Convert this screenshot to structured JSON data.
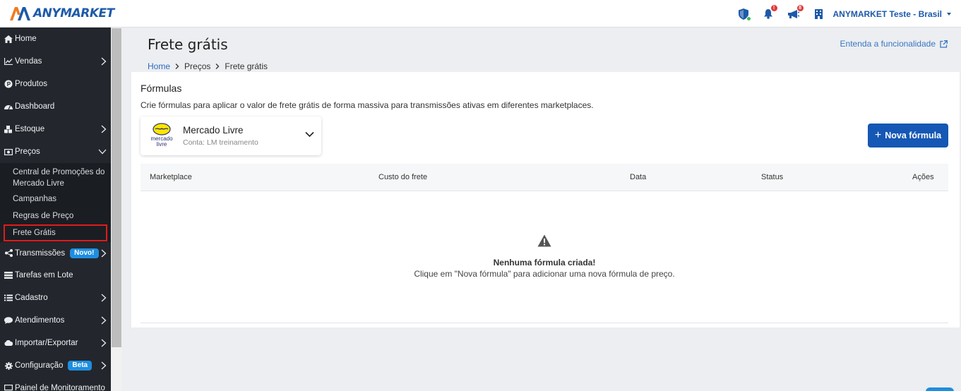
{
  "brand": {
    "name": "ANYMARKET",
    "color": "#1d5aa9",
    "accent": "#f07b1f"
  },
  "header": {
    "account_name": "ANYMARKET Teste - Brasil",
    "notifications_badge": "!",
    "announcements_badge": "8",
    "icons": [
      "shield-check-icon",
      "bell-icon",
      "megaphone-icon",
      "building-icon"
    ]
  },
  "sidebar": {
    "items": [
      {
        "label": "Home",
        "icon": "home-icon"
      },
      {
        "label": "Vendas",
        "icon": "chart-line-icon"
      },
      {
        "label": "Produtos",
        "icon": "product-icon"
      },
      {
        "label": "Dashboard",
        "icon": "dashboard-icon"
      },
      {
        "label": "Estoque",
        "icon": "cubes-icon"
      },
      {
        "label": "Preços",
        "icon": "money-icon"
      },
      {
        "label": "Transmissões",
        "icon": "share-icon",
        "badge": "Novo!"
      },
      {
        "label": "Tarefas em Lote",
        "icon": "list-icon"
      },
      {
        "label": "Cadastro",
        "icon": "list-ul-icon"
      },
      {
        "label": "Atendimentos",
        "icon": "chat-icon"
      },
      {
        "label": "Importar/Exportar",
        "icon": "cloud-icon"
      },
      {
        "label": "Configuração",
        "icon": "gear-icon",
        "badge": "Beta"
      },
      {
        "label": "Painel de Monitoramento",
        "icon": "monitor-icon"
      }
    ],
    "precos_sub": [
      {
        "label": "Central de Promoções do Mercado Livre"
      },
      {
        "label": "Campanhas"
      },
      {
        "label": "Regras de Preço"
      },
      {
        "label": "Frete Grátis"
      }
    ]
  },
  "page": {
    "title": "Frete grátis",
    "learn_link": "Entenda a funcionalidade",
    "breadcrumb": [
      "Home",
      "Preços",
      "Frete grátis"
    ]
  },
  "formulas": {
    "title": "Fórmulas",
    "description": "Crie fórmulas para aplicar o valor de frete grátis de forma massiva para transmissões ativas em diferentes marketplaces.",
    "marketplace": {
      "name": "Mercado Livre",
      "account": "Conta: LM treinamento",
      "logo_text_1": "mercado",
      "logo_text_2": "livre"
    },
    "new_button": "Nova fórmula",
    "columns": [
      "Marketplace",
      "Custo do frete",
      "Data",
      "Status",
      "Ações"
    ],
    "empty_title": "Nenhuma fórmula criada!",
    "empty_text": "Clique em \"Nova fórmula\" para adicionar uma nova fórmula de preço."
  }
}
